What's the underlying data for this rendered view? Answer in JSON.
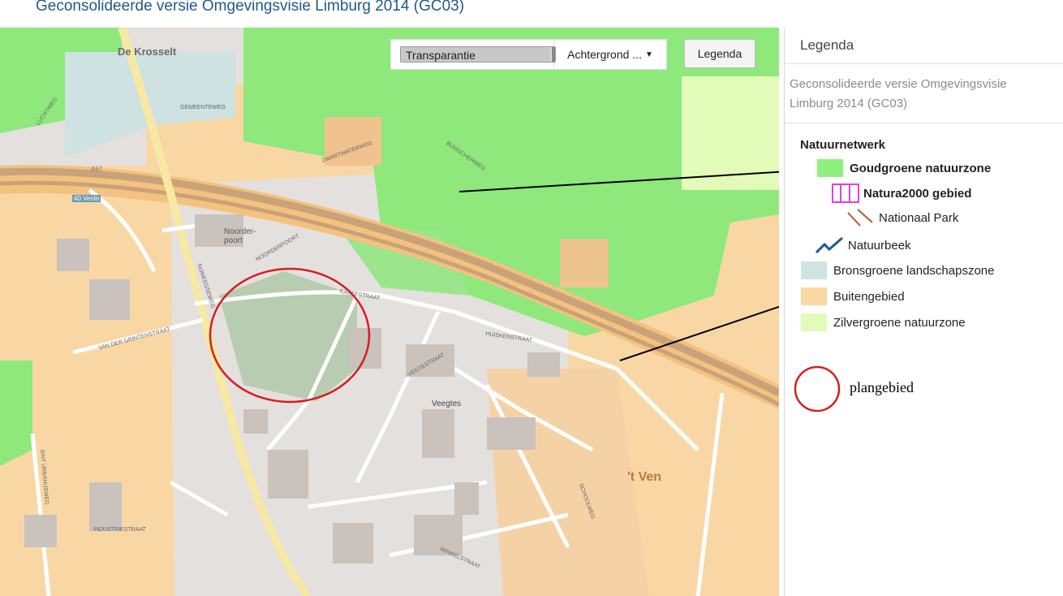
{
  "header": {
    "title": "Geconsolideerde versie Omgevingsvisie Limburg 2014 (GC03)"
  },
  "toolbar": {
    "transparency_label": "Transparantie",
    "transparency_value": 0.97,
    "background_select": "Achtergrond ...",
    "legend_button": "Legenda"
  },
  "legend": {
    "title": "Legenda",
    "subtitle": "Geconsolideerde versie Omgevingsvisie Limburg 2014 (GC03)",
    "group": "Natuurnetwerk",
    "items": [
      {
        "label": "Goudgroene natuurzone",
        "color": "#8ef07e"
      },
      {
        "label": "Natura2000 gebied",
        "color": "#e040e0"
      },
      {
        "label": "Nationaal Park",
        "color": "#b8562f"
      },
      {
        "label": "Natuurbeek",
        "color": "#1b5a8c"
      },
      {
        "label": "Bronsgroene landschapszone",
        "color": "#cfe3e3"
      },
      {
        "label": "Buitengebied",
        "color": "#fbd7a3"
      },
      {
        "label": "Zilvergroene natuurzone",
        "color": "#e3fbb8"
      }
    ]
  },
  "annotation": {
    "label": "plangebied",
    "color": "#d42020"
  },
  "map_labels": {
    "krosselt": "De Krosselt",
    "noorderpoort": "Noorder-poort",
    "veegtes": "Veegtes",
    "ven": "'t Ven",
    "a67": "A67",
    "venlo": "40 Venlo",
    "streets": [
      "LUCHTWEG",
      "GEMEENTEWEG",
      "BUISSCHERWEG",
      "ZWARTWATERWEG",
      "NOORDERPOORT",
      "NIJMEEGSEWEG",
      "RAKTESTRAAT",
      "HUISKENSTRAAT",
      "VAN DER GRINTENSTRAAT",
      "INDUSTRIESTRAAT",
      "SCHOOLWEG",
      "VEGTESTRAAT",
      "WINKELSTRAAT",
      "SINT URBANUSWEG"
    ]
  }
}
